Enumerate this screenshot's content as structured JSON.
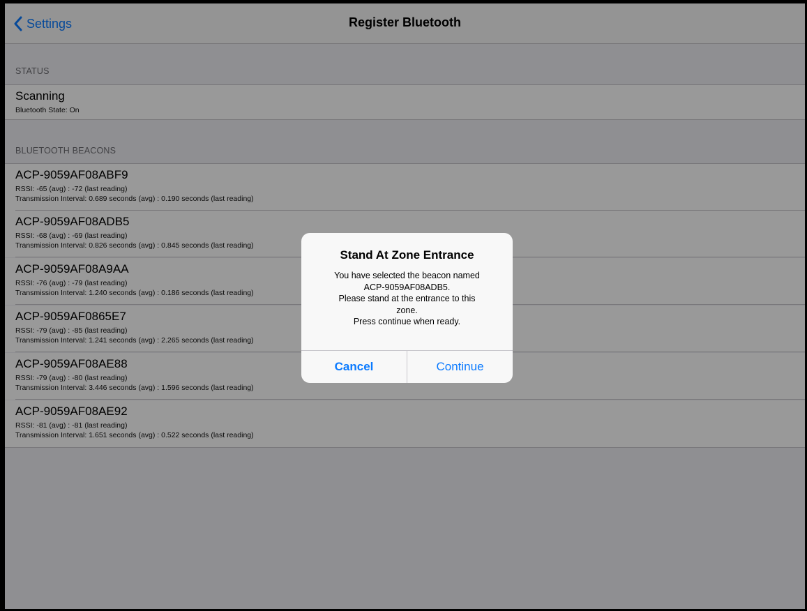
{
  "nav": {
    "back_label": "Settings",
    "title": "Register Bluetooth"
  },
  "status": {
    "header": "STATUS",
    "title": "Scanning",
    "subtitle": "Bluetooth State: On"
  },
  "beacons": {
    "header": "BLUETOOTH BEACONS",
    "items": [
      {
        "name": "ACP-9059AF08ABF9",
        "rssi": "RSSI: -65 (avg) : -72 (last reading)",
        "interval": "Transmission Interval: 0.689 seconds (avg) : 0.190 seconds (last reading)"
      },
      {
        "name": "ACP-9059AF08ADB5",
        "rssi": "RSSI: -68 (avg) : -69 (last reading)",
        "interval": "Transmission Interval: 0.826 seconds (avg) : 0.845 seconds (last reading)"
      },
      {
        "name": "ACP-9059AF08A9AA",
        "rssi": "RSSI: -76 (avg) : -79 (last reading)",
        "interval": "Transmission Interval: 1.240 seconds (avg) : 0.186 seconds (last reading)"
      },
      {
        "name": "ACP-9059AF0865E7",
        "rssi": "RSSI: -79 (avg) : -85 (last reading)",
        "interval": "Transmission Interval: 1.241 seconds (avg) : 2.265 seconds (last reading)"
      },
      {
        "name": "ACP-9059AF08AE88",
        "rssi": "RSSI: -79 (avg) : -80 (last reading)",
        "interval": "Transmission Interval: 3.446 seconds (avg) : 1.596 seconds (last reading)"
      },
      {
        "name": "ACP-9059AF08AE92",
        "rssi": "RSSI: -81 (avg) : -81 (last reading)",
        "interval": "Transmission Interval: 1.651 seconds (avg) : 0.522 seconds (last reading)"
      }
    ]
  },
  "alert": {
    "title": "Stand At Zone Entrance",
    "message_lines": [
      "You have selected the beacon named",
      "ACP-9059AF08ADB5.",
      "Please stand at the entrance to this",
      "zone.",
      "Press continue when ready."
    ],
    "cancel_label": "Cancel",
    "continue_label": "Continue"
  },
  "colors": {
    "accent": "#0a7aff",
    "group_background": "#efeff4",
    "separator": "#c8c7cc"
  },
  "icons": {
    "back": "chevron-left-icon"
  }
}
